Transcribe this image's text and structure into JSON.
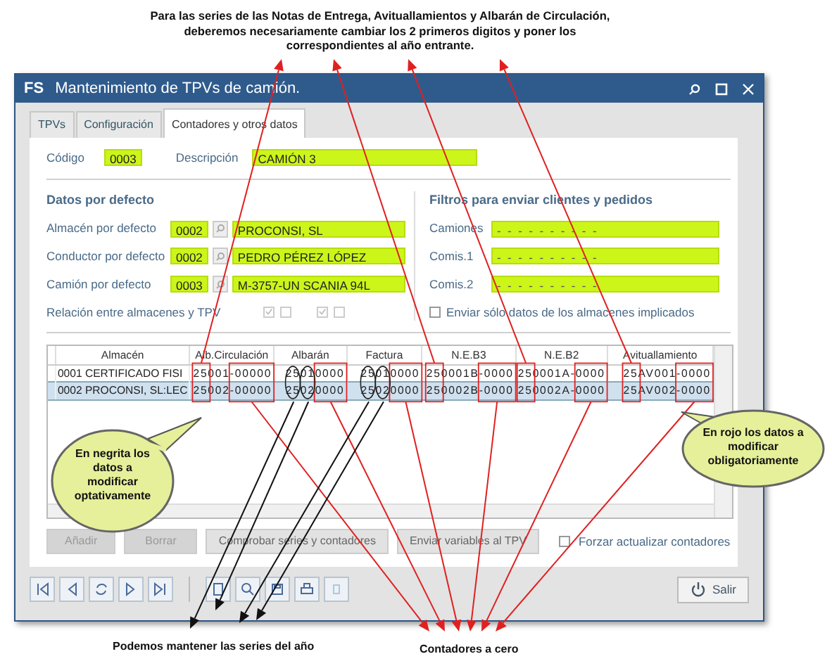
{
  "annotations": {
    "top_note": [
      "Para las series de las Notas de Entrega, Avituallamientos y Albarán de Circulación,",
      "deberemos necesariamente cambiar los 2 primeros digitos y poner los",
      "correspondientes al año entrante."
    ],
    "left_callout": "En negrita los datos a modificar optativamente",
    "right_callout": "En rojo los datos a modificar obligatoriamente",
    "bottom_left_note": "Podemos mantener las series del año",
    "bottom_right_note": "Contadores a cero"
  },
  "window": {
    "logo": "FS",
    "title": "Mantenimiento de TPVs de camión."
  },
  "tabs": [
    {
      "label": "TPVs",
      "selected": false
    },
    {
      "label": "Configuración",
      "selected": false
    },
    {
      "label": "Contadores y otros datos",
      "selected": true
    }
  ],
  "code": {
    "label": "Código",
    "value": "0003"
  },
  "description": {
    "label": "Descripción",
    "value": "CAMIÓN 3"
  },
  "defaults": {
    "heading": "Datos por defecto",
    "rows": [
      {
        "label": "Almacén por defecto",
        "code": "0002",
        "name": "PROCONSI, SL"
      },
      {
        "label": "Conductor por defecto",
        "code": "0002",
        "name": "PEDRO PÉREZ LÓPEZ"
      },
      {
        "label": "Camión por defecto",
        "code": "0003",
        "name": "M-3757-UN SCANIA 94L"
      }
    ],
    "relation": {
      "label": "Relación entre almacenes y TPV",
      "checkboxes": [
        {
          "checked": true,
          "disabled": true
        },
        {
          "checked": false,
          "disabled": true
        },
        {
          "checked": true,
          "disabled": true
        },
        {
          "checked": false,
          "disabled": true
        }
      ]
    }
  },
  "filters": {
    "heading": "Filtros para enviar clientes y pedidos",
    "rows": [
      {
        "label": "Camiones",
        "value": "-  -  -  -  -  -  -  -  -  -"
      },
      {
        "label": "Comis.1",
        "value": "-  -  -  -  -  -  -  -  -  -"
      },
      {
        "label": "Comis.2",
        "value": "-  -  -  -  -  -  -  -  -  -"
      }
    ],
    "send_only": {
      "label": "Enviar sólo datos de los almacenes implicados",
      "checked": false
    }
  },
  "table": {
    "columns": [
      "Almacén",
      "Alb.Circulación",
      "Albarán",
      "Factura",
      "N.E.B3",
      "N.E.B2",
      "Avituallamiento"
    ],
    "rows": [
      {
        "selected": false,
        "cells": [
          "0001 CERTIFICADO FISI",
          "25001-00000",
          "25010000",
          "25010000",
          "250001B-0000",
          "250001A-0000",
          "25AV001-0000"
        ]
      },
      {
        "selected": true,
        "cells": [
          "0002 PROCONSI, SL:LEC",
          "25002-00000",
          "25020000",
          "25020000",
          "250002B-0000",
          "250002A-0000",
          "25AV002-0000"
        ]
      }
    ]
  },
  "actions": [
    {
      "label": "Añadir",
      "disabled": true
    },
    {
      "label": "Borrar",
      "disabled": true
    },
    {
      "label": "Comprobar series y contadores",
      "disabled": false
    },
    {
      "label": "Enviar variables al TPV",
      "disabled": false
    }
  ],
  "force_update": {
    "label": "Forzar actualizar contadores",
    "checked": false
  },
  "exit_button": "Salir"
}
